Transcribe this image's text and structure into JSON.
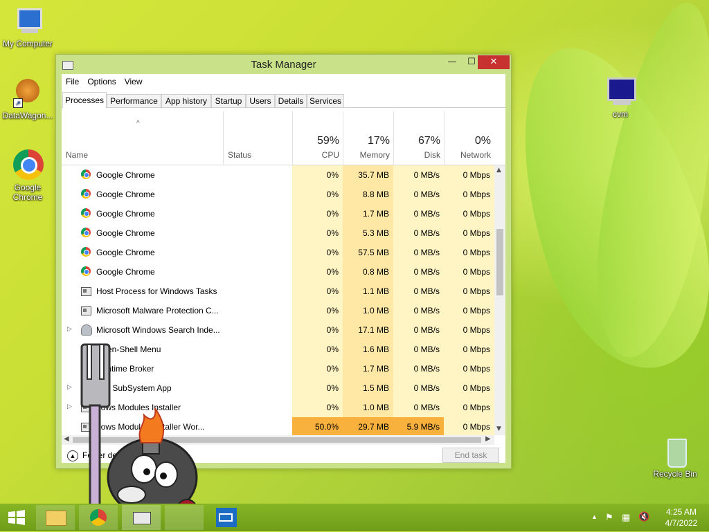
{
  "desktop": {
    "icons": [
      {
        "label": "My Computer"
      },
      {
        "label": "DataWagon..."
      },
      {
        "label": "Google Chrome"
      },
      {
        "label": "cvm"
      },
      {
        "label": "Recycle Bin"
      }
    ]
  },
  "window": {
    "title": "Task Manager",
    "controls": {
      "minimize": "—",
      "maximize": "☐",
      "close": "✕"
    },
    "menu": [
      "File",
      "Options",
      "View"
    ],
    "tabs": [
      "Processes",
      "Performance",
      "App history",
      "Startup",
      "Users",
      "Details",
      "Services"
    ],
    "active_tab": "Processes",
    "header": {
      "sort_arrow": "^",
      "name_label": "Name",
      "status_label": "Status",
      "cpu": {
        "pct": "59%",
        "label": "CPU"
      },
      "memory": {
        "pct": "17%",
        "label": "Memory"
      },
      "disk": {
        "pct": "67%",
        "label": "Disk"
      },
      "network": {
        "pct": "0%",
        "label": "Network"
      }
    },
    "processes": [
      {
        "name": "Google Chrome",
        "icon": "chrome-icon",
        "expander": "",
        "cpu": "0%",
        "memory": "35.7 MB",
        "disk": "0 MB/s",
        "network": "0 Mbps"
      },
      {
        "name": "Google Chrome",
        "icon": "chrome-icon",
        "expander": "",
        "cpu": "0%",
        "memory": "8.8 MB",
        "disk": "0 MB/s",
        "network": "0 Mbps"
      },
      {
        "name": "Google Chrome",
        "icon": "chrome-icon",
        "expander": "",
        "cpu": "0%",
        "memory": "1.7 MB",
        "disk": "0 MB/s",
        "network": "0 Mbps"
      },
      {
        "name": "Google Chrome",
        "icon": "chrome-icon",
        "expander": "",
        "cpu": "0%",
        "memory": "5.3 MB",
        "disk": "0 MB/s",
        "network": "0 Mbps"
      },
      {
        "name": "Google Chrome",
        "icon": "chrome-icon",
        "expander": "",
        "cpu": "0%",
        "memory": "57.5 MB",
        "disk": "0 MB/s",
        "network": "0 Mbps"
      },
      {
        "name": "Google Chrome",
        "icon": "chrome-icon",
        "expander": "",
        "cpu": "0%",
        "memory": "0.8 MB",
        "disk": "0 MB/s",
        "network": "0 Mbps"
      },
      {
        "name": "Host Process for Windows Tasks",
        "icon": "window-icon",
        "expander": "",
        "cpu": "0%",
        "memory": "1.1 MB",
        "disk": "0 MB/s",
        "network": "0 Mbps"
      },
      {
        "name": "Microsoft Malware Protection C...",
        "icon": "window-icon",
        "expander": "",
        "cpu": "0%",
        "memory": "1.0 MB",
        "disk": "0 MB/s",
        "network": "0 Mbps"
      },
      {
        "name": "Microsoft Windows Search Inde...",
        "icon": "user-icon",
        "expander": "▷",
        "cpu": "0%",
        "memory": "17.1 MB",
        "disk": "0 MB/s",
        "network": "0 Mbps"
      },
      {
        "name": "Open-Shell Menu",
        "icon": "shell-icon",
        "expander": "",
        "cpu": "0%",
        "memory": "1.6 MB",
        "disk": "0 MB/s",
        "network": "0 Mbps"
      },
      {
        "name": "Runtime Broker",
        "icon": "window-icon",
        "expander": "",
        "cpu": "0%",
        "memory": "1.7 MB",
        "disk": "0 MB/s",
        "network": "0 Mbps"
      },
      {
        "name": "oler SubSystem App",
        "icon": "window-icon",
        "expander": "▷",
        "cpu": "0%",
        "memory": "1.5 MB",
        "disk": "0 MB/s",
        "network": "0 Mbps"
      },
      {
        "name": "dows Modules Installer",
        "icon": "window-icon",
        "expander": "▷",
        "cpu": "0%",
        "memory": "1.0 MB",
        "disk": "0 MB/s",
        "network": "0 Mbps"
      },
      {
        "name": "dows Modules Installer Wor...",
        "icon": "window-icon",
        "expander": "",
        "cpu": "50.0%",
        "memory": "29.7 MB",
        "disk": "5.9 MB/s",
        "network": "0 Mbps",
        "hot": true
      }
    ],
    "footer": {
      "fewer_details": "Fewer details",
      "end_task": "End task"
    }
  },
  "taskbar": {
    "buttons": [
      "start-icon",
      "file-explorer-icon",
      "chrome-icon",
      "task-manager-icon",
      "mail-icon"
    ],
    "clock": {
      "time": "4:25 AM",
      "date": "4/7/2022"
    },
    "tray_arrow": "▲"
  },
  "colors": {
    "accent_window": "#c9e28a",
    "close_red": "#c7312f",
    "heat_hot": "#f9b13e",
    "heat_light": "#fff4c4",
    "taskbar": "#7aa81e"
  }
}
